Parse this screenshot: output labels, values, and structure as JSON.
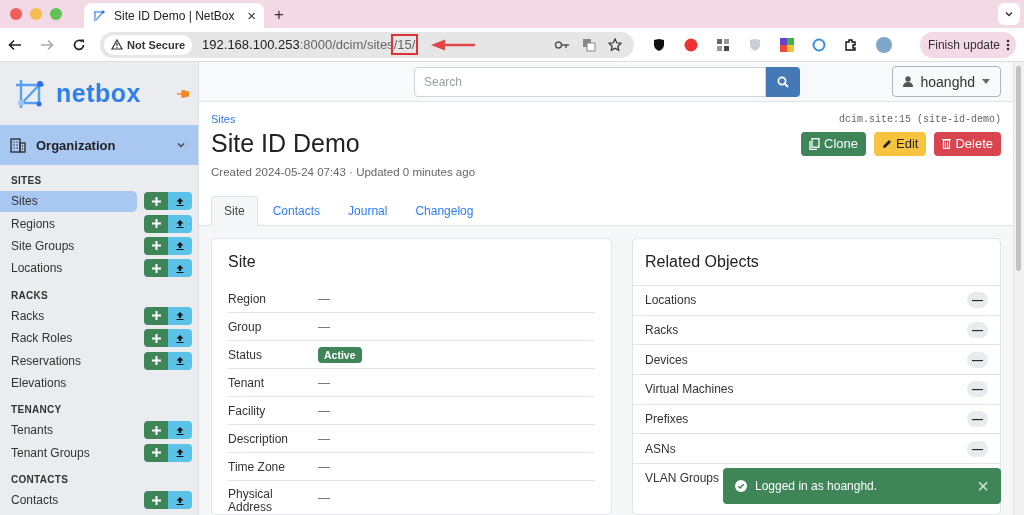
{
  "browser": {
    "tab_title": "Site ID Demo | NetBox",
    "tab_close": "×",
    "new_tab": "+",
    "security_label": "Not Secure",
    "url": {
      "host": "192.168.100.253",
      "path": ":8000/dcim/sites",
      "highlighted": "/15/"
    },
    "update_button": "Finish update"
  },
  "sidebar": {
    "logo": "netbox",
    "menu": {
      "label": "Organization",
      "expanded": true
    },
    "sections": [
      {
        "title": "SITES",
        "items": [
          {
            "label": "Sites",
            "selected": true,
            "actions": true
          },
          {
            "label": "Regions",
            "selected": false,
            "actions": true
          },
          {
            "label": "Site Groups",
            "selected": false,
            "actions": true
          },
          {
            "label": "Locations",
            "selected": false,
            "actions": true
          }
        ]
      },
      {
        "title": "RACKS",
        "items": [
          {
            "label": "Racks",
            "selected": false,
            "actions": true
          },
          {
            "label": "Rack Roles",
            "selected": false,
            "actions": true
          },
          {
            "label": "Reservations",
            "selected": false,
            "actions": true
          },
          {
            "label": "Elevations",
            "selected": false,
            "actions": false
          }
        ]
      },
      {
        "title": "TENANCY",
        "items": [
          {
            "label": "Tenants",
            "selected": false,
            "actions": true
          },
          {
            "label": "Tenant Groups",
            "selected": false,
            "actions": true
          }
        ]
      },
      {
        "title": "CONTACTS",
        "items": [
          {
            "label": "Contacts",
            "selected": false,
            "actions": true
          }
        ]
      }
    ]
  },
  "header": {
    "search_placeholder": "Search",
    "user": "hoanghd"
  },
  "page": {
    "breadcrumb": "Sites",
    "identifier": "dcim.site:15 (site-id-demo)",
    "title": "Site ID Demo",
    "meta": "Created 2024-05-24 07:43 · Updated 0 minutes ago",
    "buttons": [
      {
        "kind": "clone",
        "label": "Clone"
      },
      {
        "kind": "edit",
        "label": "Edit"
      },
      {
        "kind": "delete",
        "label": "Delete"
      }
    ],
    "tabs": [
      {
        "label": "Site",
        "selected": true
      },
      {
        "label": "Contacts",
        "selected": false
      },
      {
        "label": "Journal",
        "selected": false
      },
      {
        "label": "Changelog",
        "selected": false
      }
    ]
  },
  "site_card": {
    "title": "Site",
    "rows": [
      {
        "label": "Region",
        "value": "—"
      },
      {
        "label": "Group",
        "value": "—"
      },
      {
        "label": "Status",
        "value": "Active",
        "kind": "badge"
      },
      {
        "label": "Tenant",
        "value": "—"
      },
      {
        "label": "Facility",
        "value": "—"
      },
      {
        "label": "Description",
        "value": "—"
      },
      {
        "label": "Time Zone",
        "value": "—"
      },
      {
        "label": "Physical Address",
        "value": "—"
      }
    ]
  },
  "related_card": {
    "title": "Related Objects",
    "rows": [
      {
        "label": "Locations",
        "count": "—"
      },
      {
        "label": "Racks",
        "count": "—"
      },
      {
        "label": "Devices",
        "count": "—"
      },
      {
        "label": "Virtual Machines",
        "count": "—"
      },
      {
        "label": "Prefixes",
        "count": "—"
      },
      {
        "label": "ASNs",
        "count": "—"
      },
      {
        "label": "VLAN Groups"
      }
    ]
  },
  "toast": {
    "message": "Logged in as hoanghd.",
    "close": "×"
  }
}
